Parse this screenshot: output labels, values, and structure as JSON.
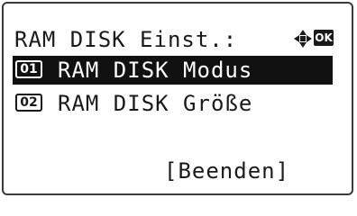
{
  "screen": {
    "title": "RAM DISK Einst.:",
    "nav_icon": "four-way-arrow-icon",
    "ok_label": "OK"
  },
  "menu": {
    "items": [
      {
        "number": "01",
        "label": "RAM DISK Modus",
        "selected": true
      },
      {
        "number": "02",
        "label": "RAM DISK Größe",
        "selected": false
      }
    ]
  },
  "softkey": {
    "label": "[Beenden]"
  },
  "colors": {
    "text": "#1a1a1a",
    "highlight_bg": "#111111",
    "highlight_fg": "#ffffff",
    "background": "#ffffff"
  }
}
